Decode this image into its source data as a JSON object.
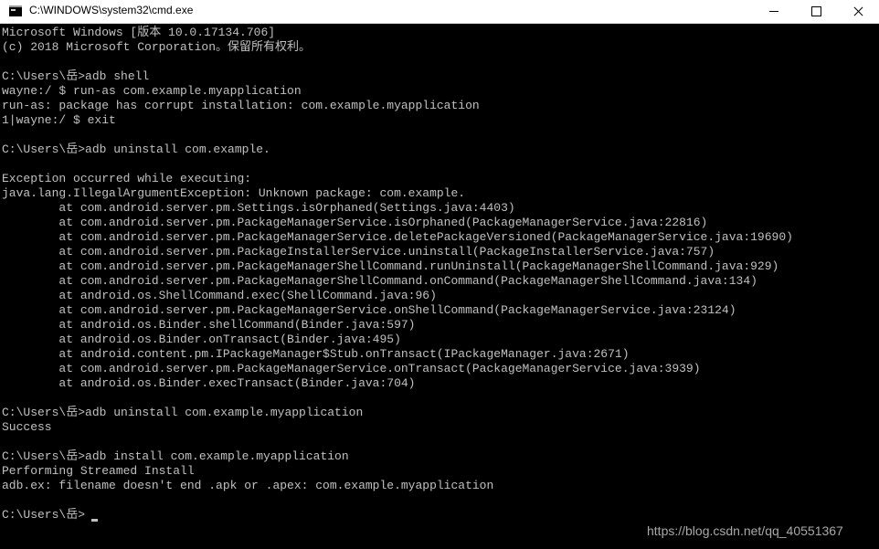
{
  "window": {
    "title": "C:\\WINDOWS\\system32\\cmd.exe",
    "icon": "cmd-console-icon",
    "controls": [
      "minimize-icon",
      "maximize-icon",
      "close-icon"
    ]
  },
  "console": {
    "background_color": "#000000",
    "text_color": "#c0c0c0",
    "lines": [
      "Microsoft Windows [版本 10.0.17134.706]",
      "(c) 2018 Microsoft Corporation。保留所有权利。",
      "",
      "C:\\Users\\岳>adb shell",
      "wayne:/ $ run-as com.example.myapplication",
      "run-as: package has corrupt installation: com.example.myapplication",
      "1|wayne:/ $ exit",
      "",
      "C:\\Users\\岳>adb uninstall com.example.",
      "",
      "Exception occurred while executing:",
      "java.lang.IllegalArgumentException: Unknown package: com.example.",
      "        at com.android.server.pm.Settings.isOrphaned(Settings.java:4403)",
      "        at com.android.server.pm.PackageManagerService.isOrphaned(PackageManagerService.java:22816)",
      "        at com.android.server.pm.PackageManagerService.deletePackageVersioned(PackageManagerService.java:19690)",
      "        at com.android.server.pm.PackageInstallerService.uninstall(PackageInstallerService.java:757)",
      "        at com.android.server.pm.PackageManagerShellCommand.runUninstall(PackageManagerShellCommand.java:929)",
      "        at com.android.server.pm.PackageManagerShellCommand.onCommand(PackageManagerShellCommand.java:134)",
      "        at android.os.ShellCommand.exec(ShellCommand.java:96)",
      "        at com.android.server.pm.PackageManagerService.onShellCommand(PackageManagerService.java:23124)",
      "        at android.os.Binder.shellCommand(Binder.java:597)",
      "        at android.os.Binder.onTransact(Binder.java:495)",
      "        at android.content.pm.IPackageManager$Stub.onTransact(IPackageManager.java:2671)",
      "        at com.android.server.pm.PackageManagerService.onTransact(PackageManagerService.java:3939)",
      "        at android.os.Binder.execTransact(Binder.java:704)",
      "",
      "C:\\Users\\岳>adb uninstall com.example.myapplication",
      "Success",
      "",
      "C:\\Users\\岳>adb install com.example.myapplication",
      "Performing Streamed Install",
      "adb.ex: filename doesn't end .apk or .apex: com.example.myapplication",
      "",
      "C:\\Users\\岳>"
    ]
  },
  "watermark": "https://blog.csdn.net/qq_40551367"
}
